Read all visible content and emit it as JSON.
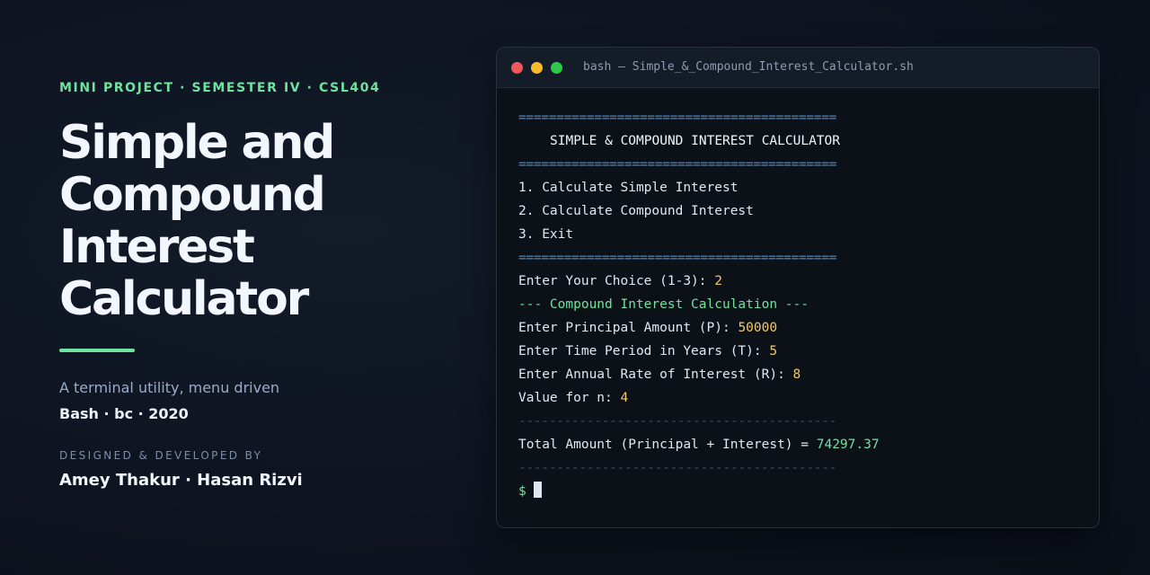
{
  "left": {
    "eyebrow": "MINI PROJECT · SEMESTER IV · CSL404",
    "title_lines": [
      "Simple and",
      "Compound",
      "Interest",
      "Calculator"
    ],
    "subtitle": "A terminal utility, menu driven",
    "stack": "Bash · bc · 2020",
    "credit_label": "DESIGNED & DEVELOPED BY",
    "authors": "Amey Thakur · Hasan Rizvi",
    "accent_color": "#6fe2a0"
  },
  "terminal": {
    "window_title": "bash — Simple_&_Compound_Interest_Calculator.sh",
    "rule_double": "==========================================",
    "rule_dashed": "------------------------------------------",
    "heading": "SIMPLE & COMPOUND INTEREST CALCULATOR",
    "menu": [
      "1. Calculate Simple Interest",
      "2. Calculate Compound Interest",
      "3. Exit"
    ],
    "choice_prompt": "Enter Your Choice (1-3): ",
    "choice_value": "2",
    "section_title": "--- Compound Interest Calculation ---",
    "inputs": [
      {
        "label": "Enter Principal Amount (P): ",
        "value": "50000"
      },
      {
        "label": "Enter Time Period in Years (T): ",
        "value": "5"
      },
      {
        "label": "Enter Annual Rate of Interest (R): ",
        "value": "8"
      },
      {
        "label": "Value for n: ",
        "value": "4"
      }
    ],
    "result_label": "Total Amount (Principal + Interest) = ",
    "result_value": "74297.37",
    "shell_prompt": "$"
  }
}
